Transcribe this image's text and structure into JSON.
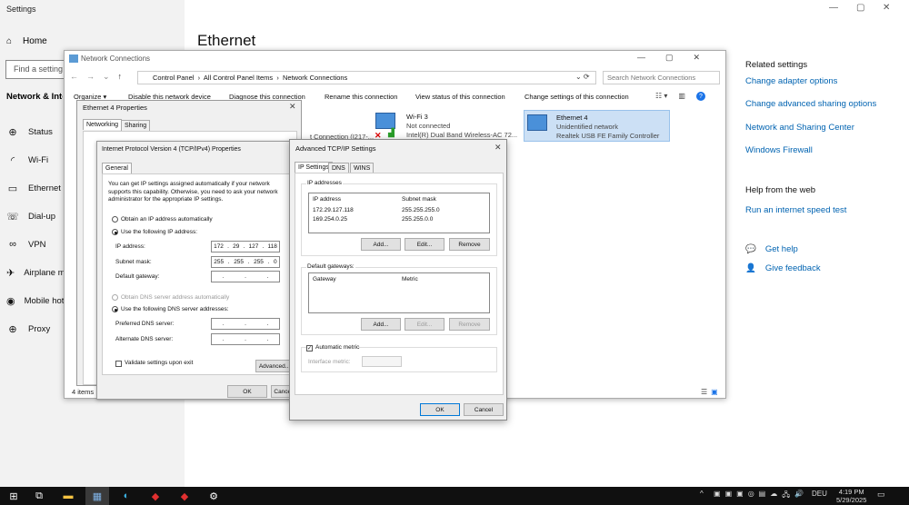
{
  "settings": {
    "window_title": "Settings",
    "home_label": "Home",
    "search_placeholder": "Find a setting",
    "section_title": "Network & Internet",
    "nav": [
      {
        "label": "Status",
        "icon": "globe-icon"
      },
      {
        "label": "Wi-Fi",
        "icon": "wifi-icon"
      },
      {
        "label": "Ethernet",
        "icon": "ethernet-icon"
      },
      {
        "label": "Dial-up",
        "icon": "dialup-icon"
      },
      {
        "label": "VPN",
        "icon": "vpn-icon"
      },
      {
        "label": "Airplane mode",
        "icon": "airplane-icon"
      },
      {
        "label": "Mobile hotspot",
        "icon": "hotspot-icon"
      },
      {
        "label": "Proxy",
        "icon": "proxy-icon"
      }
    ],
    "page_title": "Ethernet",
    "related_title": "Related settings",
    "related_links": [
      "Change adapter options",
      "Change advanced sharing options",
      "Network and Sharing Center",
      "Windows Firewall"
    ],
    "help_title": "Help from the web",
    "help_links": [
      "Run an internet speed test"
    ],
    "get_help": "Get help",
    "give_feedback": "Give feedback"
  },
  "netconn": {
    "title": "Network Connections",
    "breadcrumb": [
      "Control Panel",
      "All Control Panel Items",
      "Network Connections"
    ],
    "search_placeholder": "Search Network Connections",
    "toolbar": [
      "Organize ▾",
      "Disable this network device",
      "Diagnose this connection",
      "Rename this connection",
      "View status of this connection",
      "Change settings of this connection"
    ],
    "connections": [
      {
        "name": "t Connection (I217-...",
        "status": "",
        "adapter": ""
      },
      {
        "name": "Wi-Fi 3",
        "status": "Not connected",
        "adapter": "Intel(R) Dual Band Wireless-AC 72..."
      },
      {
        "name": "Ethernet 4",
        "status": "Unidentified network",
        "adapter": "Realtek USB FE Family Controller"
      }
    ],
    "item_count": "4 items"
  },
  "eth4": {
    "title": "Ethernet 4 Properties",
    "tabs": [
      "Networking",
      "Sharing"
    ]
  },
  "ipv4": {
    "title": "Internet Protocol Version 4 (TCP/IPv4) Properties",
    "tab": "General",
    "intro": "You can get IP settings assigned automatically if your network supports this capability. Otherwise, you need to ask your network administrator for the appropriate IP settings.",
    "obtain_auto": "Obtain an IP address automatically",
    "use_following": "Use the following IP address:",
    "ip_label": "IP address:",
    "ip_value": [
      "172",
      "29",
      "127",
      "118"
    ],
    "mask_label": "Subnet mask:",
    "mask_value": [
      "255",
      "255",
      "255",
      "0"
    ],
    "gateway_label": "Default gateway:",
    "dns_auto": "Obtain DNS server address automatically",
    "dns_use": "Use the following DNS server addresses:",
    "preferred_dns": "Preferred DNS server:",
    "alternate_dns": "Alternate DNS server:",
    "validate": "Validate settings upon exit",
    "advanced": "Advanced...",
    "ok": "OK",
    "cancel": "Cancel"
  },
  "adv": {
    "title": "Advanced TCP/IP Settings",
    "tabs": [
      "IP Settings",
      "DNS",
      "WINS"
    ],
    "ip_group": "IP addresses",
    "col_ip": "IP address",
    "col_mask": "Subnet mask",
    "rows": [
      {
        "ip": "172.29.127.118",
        "mask": "255.255.255.0"
      },
      {
        "ip": "169.254.0.25",
        "mask": "255.255.0.0"
      }
    ],
    "add": "Add...",
    "edit": "Edit...",
    "remove": "Remove",
    "gw_group": "Default gateways:",
    "col_gateway": "Gateway",
    "col_metric": "Metric",
    "auto_metric": "Automatic metric",
    "interface_metric": "Interface metric:",
    "ok": "OK",
    "cancel": "Cancel"
  },
  "taskbar": {
    "time": "4:19 PM",
    "date": "5/29/2025",
    "lang": "DEU"
  }
}
